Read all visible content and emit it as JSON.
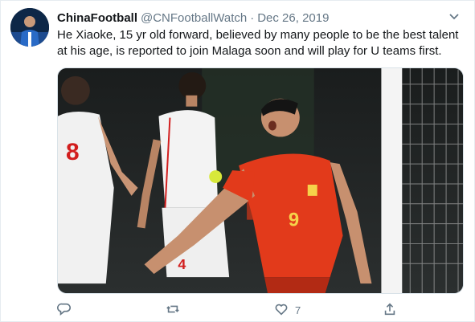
{
  "tweet": {
    "author_name": "ChinaFootball",
    "handle": "@CNFootballWatch",
    "separator": "·",
    "date": "Dec 26, 2019",
    "text": "He Xiaoke, 15 yr old forward, believed by many people to be the best talent at his age, is reported to join Malaga soon and will play for U teams first.",
    "like_count": "7"
  },
  "icons": {
    "menu": "chevron-down-icon",
    "reply": "reply-icon",
    "retweet": "retweet-icon",
    "like": "heart-icon",
    "share": "share-icon"
  },
  "colors": {
    "secondary_text": "#657786",
    "primary_text": "#14171a",
    "home_kit": "#e23a1b",
    "away_kit": "#f2f2f2"
  },
  "media": {
    "away_number_left": "8",
    "away_number_right": "4",
    "home_number": "9"
  }
}
